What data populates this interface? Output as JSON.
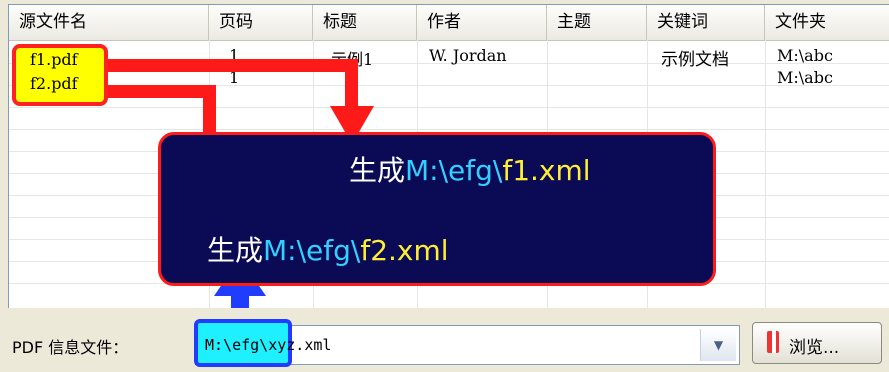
{
  "columns": [
    "源文件名",
    "页码",
    "标题",
    "作者",
    "主题",
    "关键词",
    "文件夹"
  ],
  "rows": [
    {
      "file": "f1.pdf",
      "page": "1",
      "title": "示例1",
      "author": "W. Jordan",
      "subject": "",
      "keywords": "示例文档",
      "folder": "M:\\abc"
    },
    {
      "file": "f2.pdf",
      "page": "1",
      "title": "",
      "author": "",
      "subject": "",
      "keywords": "",
      "folder": "M:\\abc"
    }
  ],
  "callout": {
    "line1": {
      "prefix": "生成",
      "dir": "M:\\efg\\",
      "name": "f1.xml"
    },
    "line2": {
      "prefix": "生成",
      "dir": "M:\\efg\\",
      "name": "f2.xml"
    }
  },
  "info_file": {
    "label": "PDF 信息文件：",
    "value": "M:\\efg\\xyz.xml",
    "highlight": "M:\\efg\\"
  },
  "browse_label": "浏览...",
  "colors": {
    "arrow_red": "#ff1a1a",
    "arrow_blue": "#1f3cff",
    "bubble": "#0a0a55",
    "cyan": "#33d0ff",
    "yellow": "#ffee33"
  }
}
